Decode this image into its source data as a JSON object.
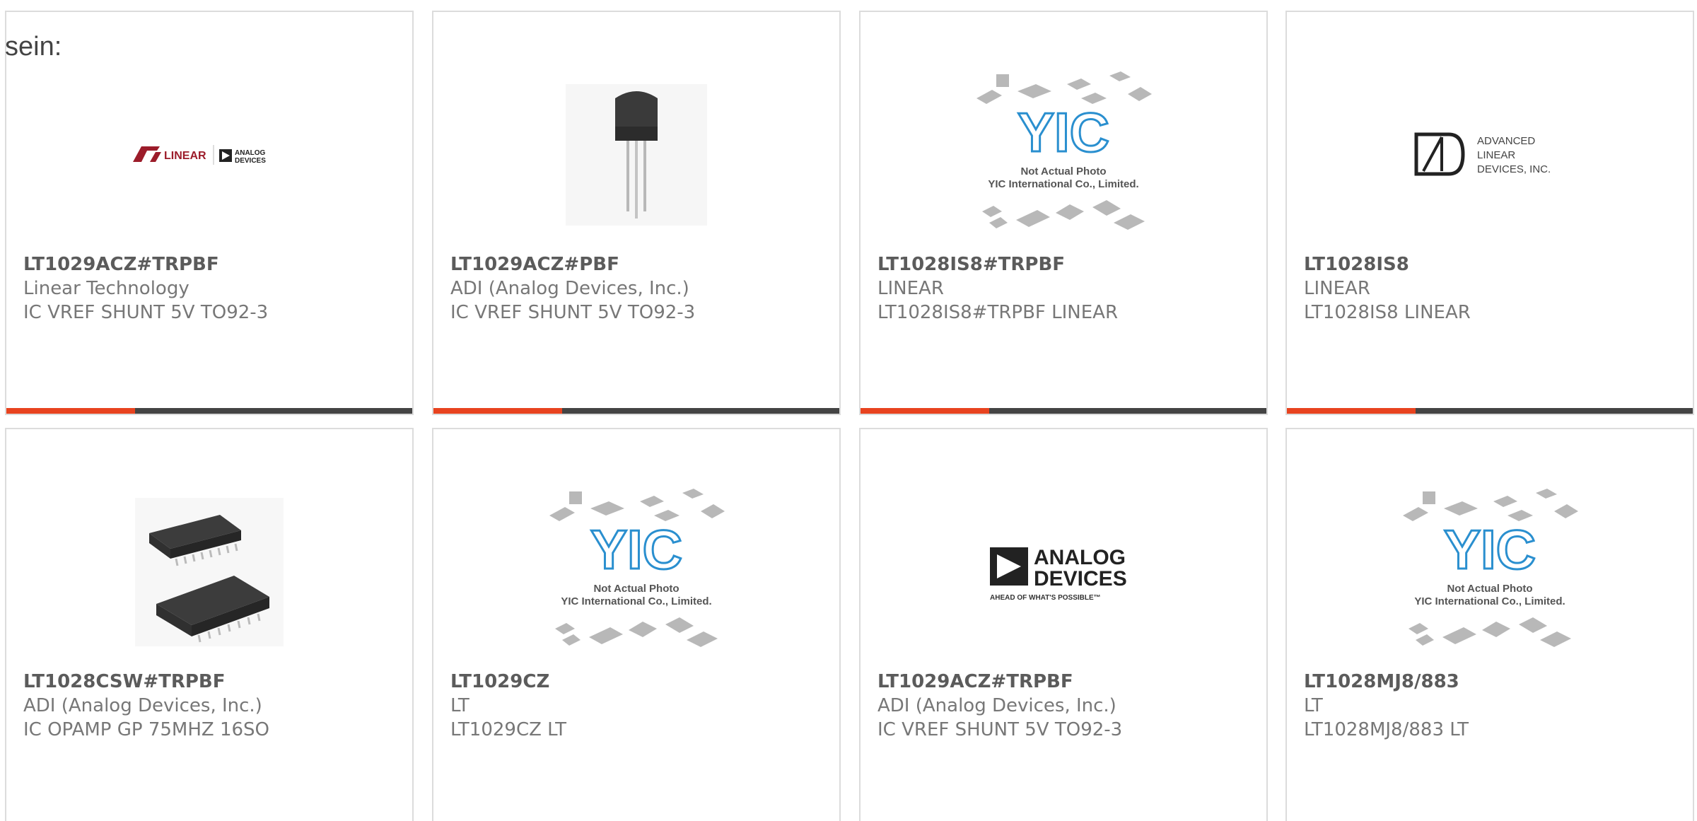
{
  "intro_text": "sein:",
  "products": [
    {
      "part_number": "LT1029ACZ#TRPBF",
      "manufacturer": "Linear Technology",
      "description": "IC VREF SHUNT 5V TO92-3",
      "image": "linear-analog-logo",
      "logo_text_linear": "LINEAR",
      "logo_text_analog": "ANALOG",
      "logo_text_devices": "DEVICES"
    },
    {
      "part_number": "LT1029ACZ#PBF",
      "manufacturer": "ADI (Analog Devices, Inc.)",
      "description": "IC VREF SHUNT 5V TO92-3",
      "image": "to92-transistor-photo"
    },
    {
      "part_number": "LT1028IS8#TRPBF",
      "manufacturer": "LINEAR",
      "description": "LT1028IS8#TRPBF LINEAR",
      "image": "yic-placeholder",
      "placeholder_line1": "Not Actual Photo",
      "placeholder_line2": "YIC International Co., Limited.",
      "placeholder_logo": "YIC"
    },
    {
      "part_number": "LT1028IS8",
      "manufacturer": "LINEAR",
      "description": "LT1028IS8 LINEAR",
      "image": "advanced-linear-devices-logo",
      "logo_lines": [
        "ADVANCED",
        "LINEAR",
        "DEVICES, INC."
      ]
    },
    {
      "part_number": "LT1028CSW#TRPBF",
      "manufacturer": "ADI (Analog Devices, Inc.)",
      "description": "IC OPAMP GP 75MHZ 16SO",
      "image": "soic-chip-photo"
    },
    {
      "part_number": "LT1029CZ",
      "manufacturer": "LT",
      "description": "LT1029CZ LT",
      "image": "yic-placeholder",
      "placeholder_line1": "Not Actual Photo",
      "placeholder_line2": "YIC International Co., Limited.",
      "placeholder_logo": "YIC"
    },
    {
      "part_number": "LT1029ACZ#TRPBF",
      "manufacturer": "ADI (Analog Devices, Inc.)",
      "description": "IC VREF SHUNT 5V TO92-3",
      "image": "analog-devices-logo",
      "logo_line1": "ANALOG",
      "logo_line2": "DEVICES",
      "tagline": "AHEAD OF WHAT'S POSSIBLE™"
    },
    {
      "part_number": "LT1028MJ8/883",
      "manufacturer": "LT",
      "description": "LT1028MJ8/883 LT",
      "image": "yic-placeholder",
      "placeholder_line1": "Not Actual Photo",
      "placeholder_line2": "YIC International Co., Limited.",
      "placeholder_logo": "YIC"
    }
  ],
  "colors": {
    "accent": "#e8431f",
    "bar": "#444444",
    "border": "#dcdcdc"
  }
}
